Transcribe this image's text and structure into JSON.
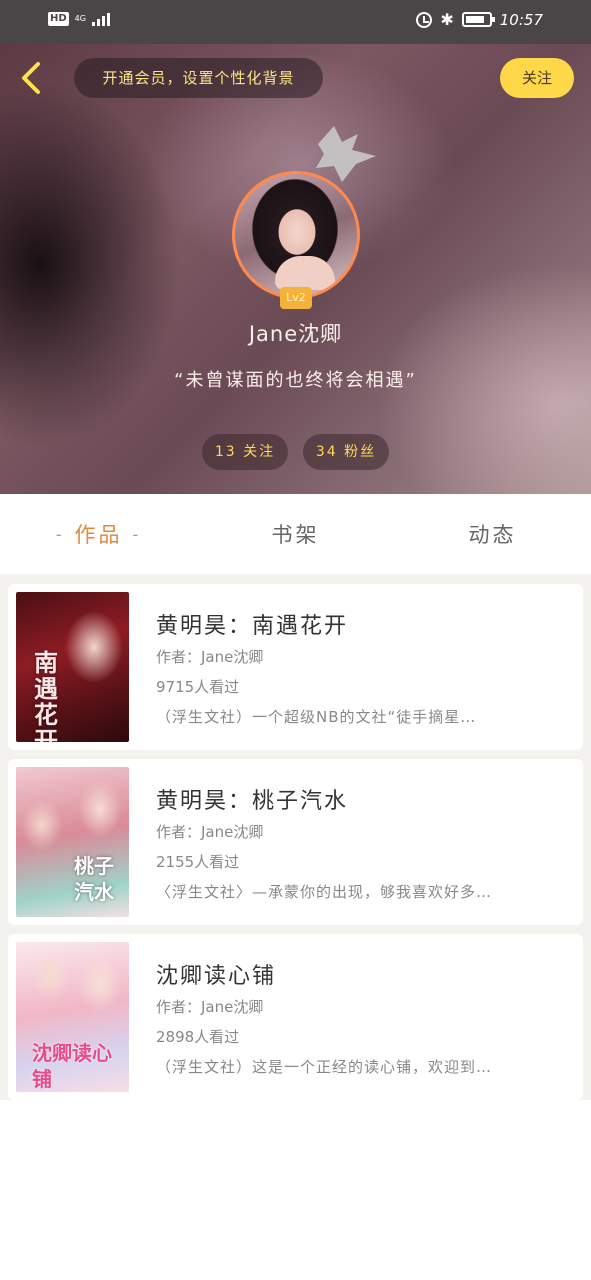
{
  "status_bar": {
    "hd": "HD",
    "network": "4G",
    "time": "10:57"
  },
  "header": {
    "vip_prompt": "开通会员，设置个性化背景",
    "follow_label": "关注",
    "level": "Lv2",
    "username": "Jane沈卿",
    "motto": "“未曾谋面的也终将会相遇”",
    "following": "13 关注",
    "fans": "34 粉丝",
    "colors": {
      "accent": "#ffd84a",
      "avatar_border": "#ff8a4d",
      "level_badge": "#f5b23a"
    }
  },
  "tabs": [
    {
      "label": "作品",
      "active": true
    },
    {
      "label": "书架",
      "active": false
    },
    {
      "label": "动态",
      "active": false
    }
  ],
  "works": [
    {
      "title": "黄明昊：南遇花开",
      "author": "作者：Jane沈卿",
      "views": "9715人看过",
      "description": "（浮生文社）一个超级NB的文社“徒手摘星…",
      "cover_text": "南遇花开"
    },
    {
      "title": "黄明昊：桃子汽水",
      "author": "作者：Jane沈卿",
      "views": "2155人看过",
      "description": "〈浮生文社〉—承蒙你的出现，够我喜欢好多…",
      "cover_text": "桃子汽水"
    },
    {
      "title": "沈卿读心铺",
      "author": "作者：Jane沈卿",
      "views": "2898人看过",
      "description": "（浮生文社）这是一个正经的读心铺，欢迎到…",
      "cover_text": "沈卿读心铺"
    }
  ]
}
